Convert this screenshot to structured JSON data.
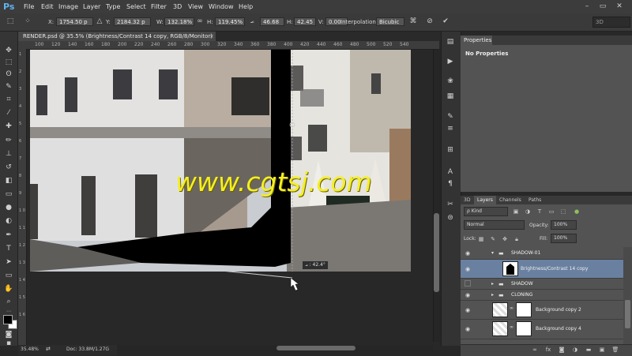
{
  "menu": {
    "logo": "Ps",
    "items": [
      "File",
      "Edit",
      "Image",
      "Layer",
      "Type",
      "Select",
      "Filter",
      "3D",
      "View",
      "Window",
      "Help"
    ]
  },
  "window_controls": {
    "minimize": "–",
    "restore": "▭",
    "close": "✕"
  },
  "options": {
    "x_label": "X:",
    "x_value": "1754.50 p",
    "y_label": "Y:",
    "y_value": "2184.32 p",
    "w_label": "W:",
    "w_value": "132.18%",
    "h_label": "H:",
    "h_value": "119.45%",
    "angle_value": "46.68",
    "hskew_label": "H:",
    "hskew_value": "42.45",
    "vskew_label": "V:",
    "vskew_value": "0.00",
    "interp_label": "Interpolation:",
    "interp_value": "Bicubic",
    "workspace_value": "3D"
  },
  "document": {
    "tab_title": "RENDER.psd @ 35.5% (Brightness/Contrast 14 copy, RGB/8/Monitor) *",
    "tab_close": "×",
    "ruler_top": [
      "100",
      "120",
      "140",
      "160",
      "180",
      "200",
      "220",
      "240",
      "260",
      "280",
      "300",
      "320",
      "340",
      "360",
      "380",
      "400",
      "420",
      "440",
      "460",
      "480",
      "500",
      "520",
      "540"
    ],
    "ruler_left": [
      "1",
      "2",
      "3",
      "4",
      "5",
      "6",
      "7",
      "8",
      "9",
      "1 0",
      "1 1",
      "1 2",
      "1 3",
      "1 4",
      "1 5",
      "1 6"
    ],
    "watermark": "www.cgtsj.com",
    "angle_tooltip": "⦟ : 42.4°",
    "zoom_status": "35.48%",
    "doc_status": "Doc: 33.8M/1.27G"
  },
  "properties": {
    "tab_label": "Properties",
    "empty_label": "No Properties"
  },
  "layers": {
    "tabs": [
      "3D",
      "Layers",
      "Channels",
      "Paths"
    ],
    "active_tab": "Layers",
    "filter_value": "ρ Kind",
    "blend_mode": "Normal",
    "opacity_label": "Opacity:",
    "opacity_value": "100%",
    "lock_label": "Lock:",
    "fill_label": "Fill:",
    "fill_value": "100%",
    "rows": [
      {
        "name": "SHADOW-01",
        "type": "group",
        "expanded": true,
        "visible": true
      },
      {
        "name": "Brightness/Contrast 14 copy",
        "type": "adjustment",
        "selected": true,
        "visible": true
      },
      {
        "name": "SHADOW",
        "type": "group",
        "expanded": false,
        "visible": false
      },
      {
        "name": "CLONING",
        "type": "group",
        "expanded": false,
        "visible": true
      },
      {
        "name": "Background copy 2",
        "type": "layer",
        "visible": true
      },
      {
        "name": "Background copy 4",
        "type": "layer",
        "visible": true
      }
    ]
  },
  "colors": {
    "accent_selected_row": "#6a80a0",
    "watermark": "#f4ef23",
    "ps_logo": "#5fb3f0"
  }
}
